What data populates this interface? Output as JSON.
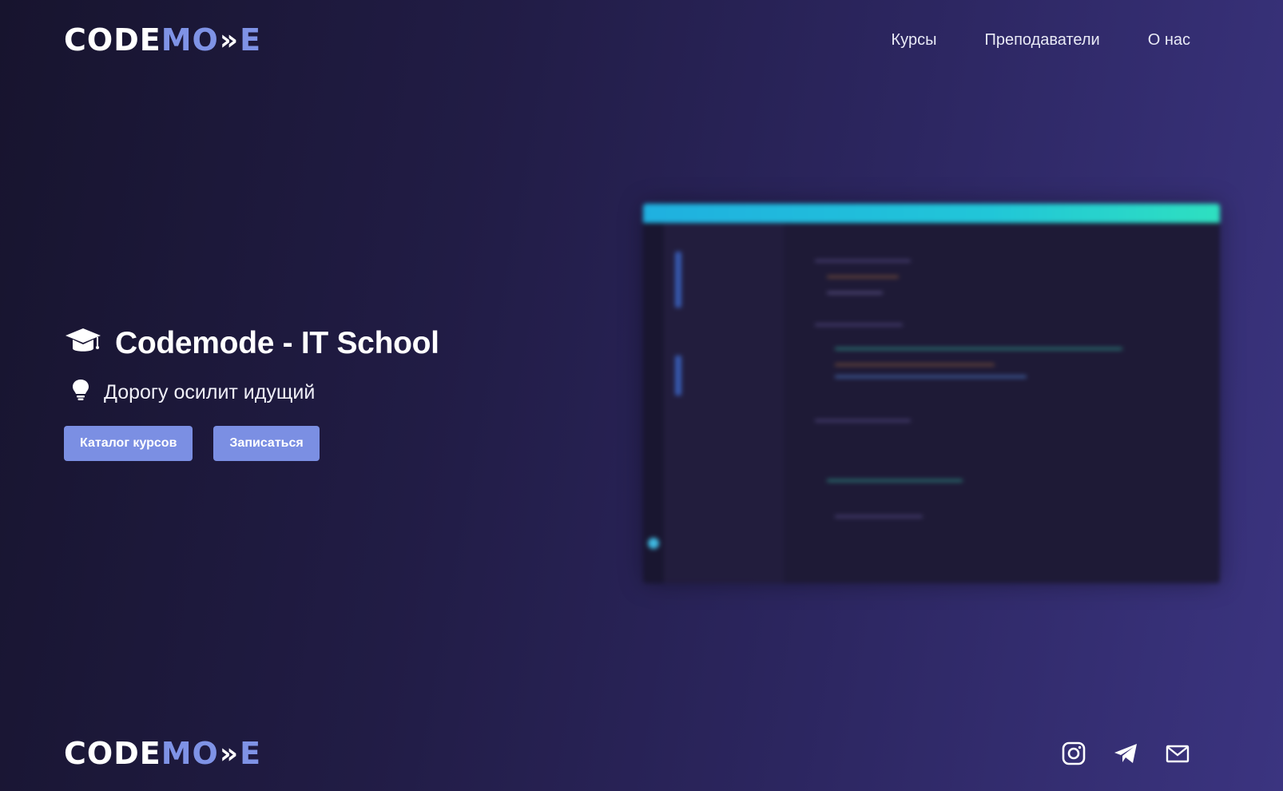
{
  "brand": {
    "logo_part1": "CODE",
    "logo_part2": "MO",
    "logo_arrows": "»",
    "logo_part3": "E",
    "accent": "#7f93e6"
  },
  "nav": {
    "items": [
      {
        "label": "Курсы"
      },
      {
        "label": "Преподаватели"
      },
      {
        "label": "О нас"
      }
    ]
  },
  "hero": {
    "title": "Codemode - IT School",
    "title_icon": "graduation-cap-icon",
    "subtitle": "Дорогу осилит идущий",
    "subtitle_icon": "lightbulb-icon",
    "buttons": [
      {
        "label": "Каталог курсов"
      },
      {
        "label": "Записаться"
      }
    ],
    "button_color": "#7b8fe3"
  },
  "footer": {
    "social_icons": [
      "instagram-icon",
      "telegram-icon",
      "mail-icon"
    ]
  }
}
